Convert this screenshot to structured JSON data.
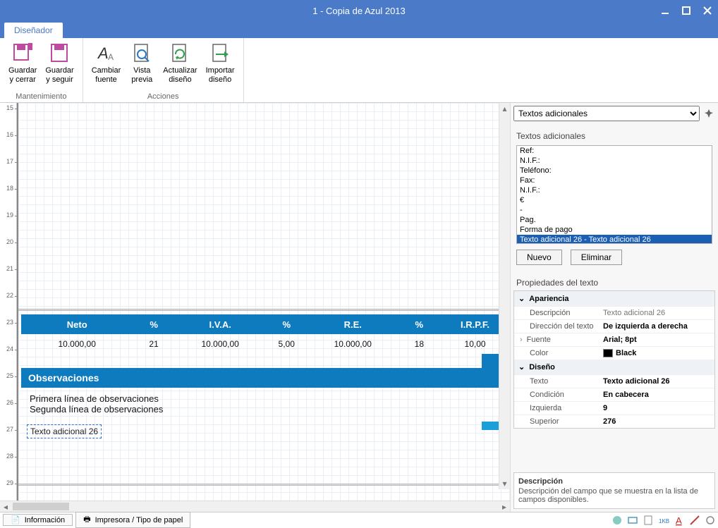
{
  "window": {
    "title": "1 - Copia de Azul 2013"
  },
  "tab": {
    "designer": "Diseñador"
  },
  "ribbon": {
    "group1": "Mantenimiento",
    "group2": "Acciones",
    "btn_save_close": "Guardar\ny cerrar",
    "btn_save_continue": "Guardar\ny seguir",
    "btn_change_font": "Cambiar\nfuente",
    "btn_preview": "Vista\nprevia",
    "btn_update_design": "Actualizar\ndiseño",
    "btn_import_design": "Importar\ndiseño"
  },
  "panel_selector": "Textos adicionales",
  "textos_title": "Textos adicionales",
  "textos_items": [
    "Ref:",
    "N.I.F.:",
    "Teléfono:",
    "Fax:",
    "N.I.F.:",
    "€",
    "-",
    "Pag.",
    "Forma de pago"
  ],
  "textos_selected": "Texto adicional 26 - Texto adicional 26",
  "btn_nuevo": "Nuevo",
  "btn_eliminar": "Eliminar",
  "prop_title": "Propiedades del texto",
  "prop": {
    "cat_apariencia": "Apariencia",
    "descripcion_k": "Descripción",
    "descripcion_v": "Texto adicional 26",
    "direccion_k": "Dirección del texto",
    "direccion_v": "De izquierda a derecha",
    "fuente_k": "Fuente",
    "fuente_v": "Arial; 8pt",
    "color_k": "Color",
    "color_v": "Black",
    "cat_diseno": "Diseño",
    "texto_k": "Texto",
    "texto_v": "Texto adicional 26",
    "condicion_k": "Condición",
    "condicion_v": "En cabecera",
    "izquierda_k": "Izquierda",
    "izquierda_v": "9",
    "superior_k": "Superior",
    "superior_v": "276"
  },
  "desc_box": {
    "title": "Descripción",
    "body": "Descripción del campo que se muestra en la lista de campos disponibles."
  },
  "report": {
    "h_neto": "Neto",
    "h_p": "%",
    "h_iva": "I.V.A.",
    "h_re": "R.E.",
    "h_irpf": "I.R.P.F.",
    "r_neto": "10.000,00",
    "r_p1": "21",
    "r_iva": "10.000,00",
    "r_p2": "5,00",
    "r_re": "10.000,00",
    "r_p3": "18",
    "r_irpf": "10,00",
    "obs_title": "Observaciones",
    "obs_l1": "Primera línea de observaciones",
    "obs_l2": "Segunda  línea de observaciones",
    "sel_text": "Texto adicional 26"
  },
  "ruler": {
    "m15": "15",
    "m16": "16",
    "m17": "17",
    "m18": "18",
    "m19": "19",
    "m20": "20",
    "m21": "21",
    "m22": "22",
    "m23": "23",
    "m24": "24",
    "m25": "25",
    "m26": "26",
    "m27": "27",
    "m28": "28",
    "m29": "29"
  },
  "footer": {
    "info": "Información",
    "printer": "Impresora / Tipo de papel"
  }
}
